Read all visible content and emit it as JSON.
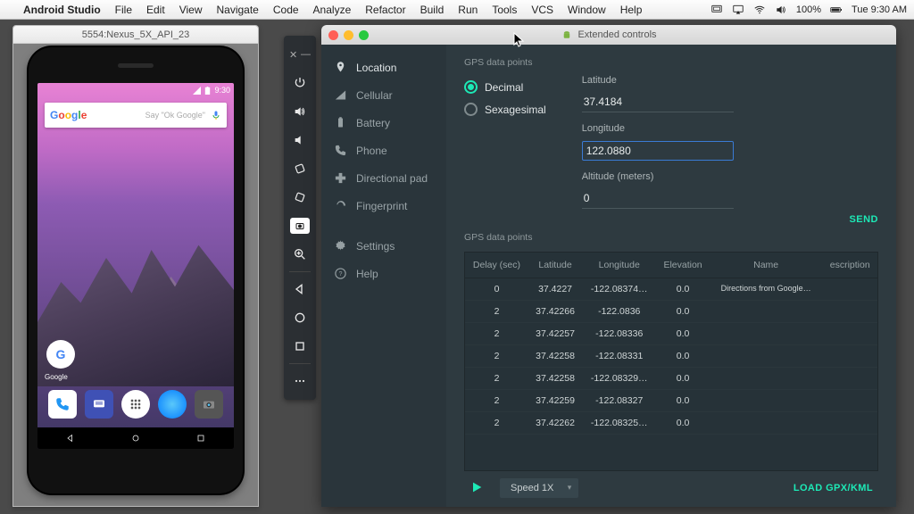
{
  "menubar": {
    "app": "Android Studio",
    "items": [
      "File",
      "Edit",
      "View",
      "Navigate",
      "Code",
      "Analyze",
      "Refactor",
      "Build",
      "Run",
      "Tools",
      "VCS",
      "Window",
      "Help"
    ],
    "battery": "100%",
    "clock": "Tue 9:30 AM"
  },
  "emulator": {
    "title": "5554:Nexus_5X_API_23",
    "status_time": "9:30",
    "search_placeholder": "Say \"Ok Google\"",
    "google_label": "Google"
  },
  "ext": {
    "title": "Extended controls",
    "nav": {
      "location": "Location",
      "cellular": "Cellular",
      "battery": "Battery",
      "phone": "Phone",
      "dpad": "Directional pad",
      "fingerprint": "Fingerprint",
      "settings": "Settings",
      "help": "Help"
    },
    "section_label": "GPS data points",
    "radio_decimal": "Decimal",
    "radio_sexagesimal": "Sexagesimal",
    "lat_label": "Latitude",
    "lat_value": "37.4184",
    "lon_label": "Longitude",
    "lon_value": "122.0880",
    "alt_label": "Altitude (meters)",
    "alt_value": "0",
    "send": "SEND",
    "table_section": "GPS data points",
    "columns": {
      "delay": "Delay (sec)",
      "lat": "Latitude",
      "lon": "Longitude",
      "elev": "Elevation",
      "name": "Name",
      "desc": "escription"
    },
    "rows": [
      {
        "delay": "0",
        "lat": "37.4227",
        "lon": "-122.08374…",
        "elev": "0.0",
        "name": "Directions from Google…",
        "desc": ""
      },
      {
        "delay": "2",
        "lat": "37.42266",
        "lon": "-122.0836",
        "elev": "0.0",
        "name": "",
        "desc": ""
      },
      {
        "delay": "2",
        "lat": "37.42257",
        "lon": "-122.08336",
        "elev": "0.0",
        "name": "",
        "desc": ""
      },
      {
        "delay": "2",
        "lat": "37.42258",
        "lon": "-122.08331",
        "elev": "0.0",
        "name": "",
        "desc": ""
      },
      {
        "delay": "2",
        "lat": "37.42258",
        "lon": "-122.08329…",
        "elev": "0.0",
        "name": "",
        "desc": ""
      },
      {
        "delay": "2",
        "lat": "37.42259",
        "lon": "-122.08327",
        "elev": "0.0",
        "name": "",
        "desc": ""
      },
      {
        "delay": "2",
        "lat": "37.42262",
        "lon": "-122.08325…",
        "elev": "0.0",
        "name": "",
        "desc": ""
      }
    ],
    "speed": "Speed 1X",
    "load": "LOAD GPX/KML"
  }
}
